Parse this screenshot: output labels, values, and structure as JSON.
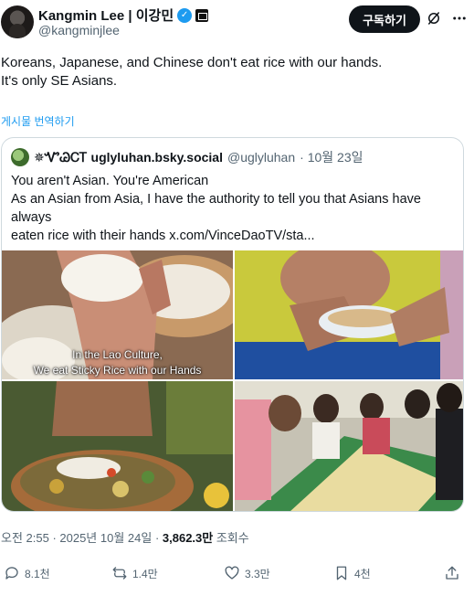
{
  "author": {
    "name": "Kangmin Lee | 이강민",
    "handle": "@kangminjlee",
    "verified_icon": "verified-badge-icon",
    "affiliate_icon": "affiliate-badge-icon"
  },
  "header": {
    "subscribe_label": "구독하기"
  },
  "tweet": {
    "line1": "Koreans, Japanese, and Chinese don't eat rice with our hands.",
    "line2": "It's only SE Asians.",
    "translate_label": "게시물 번역하기"
  },
  "quote": {
    "display_name": "✵ᏉᏊᏟᎢ uglyluhan.bsky.social",
    "handle": "@uglyluhan",
    "date": "· 10월 23일",
    "line1": "You aren't Asian. You're American",
    "line2": "As an Asian from Asia, I have the authority to tell you that Asians have always",
    "line3": "eaten rice with their hands  x.com/VinceDaoTV/sta..."
  },
  "media": {
    "caption_line1": "In the Lao Culture,",
    "caption_line2": "We eat Sticky Rice with our Hands"
  },
  "meta": {
    "time_date": "오전 2:55 · 2025년 10월 24일 · ",
    "views": "3,862.3만",
    "views_label": " 조회수"
  },
  "actions": {
    "replies": "8.1천",
    "reposts": "1.4만",
    "likes": "3.3만",
    "bookmarks": "4천"
  },
  "colors": {
    "accent": "#1d9bf0",
    "text": "#0f1419",
    "muted": "#536471",
    "border": "#cfd9de"
  }
}
